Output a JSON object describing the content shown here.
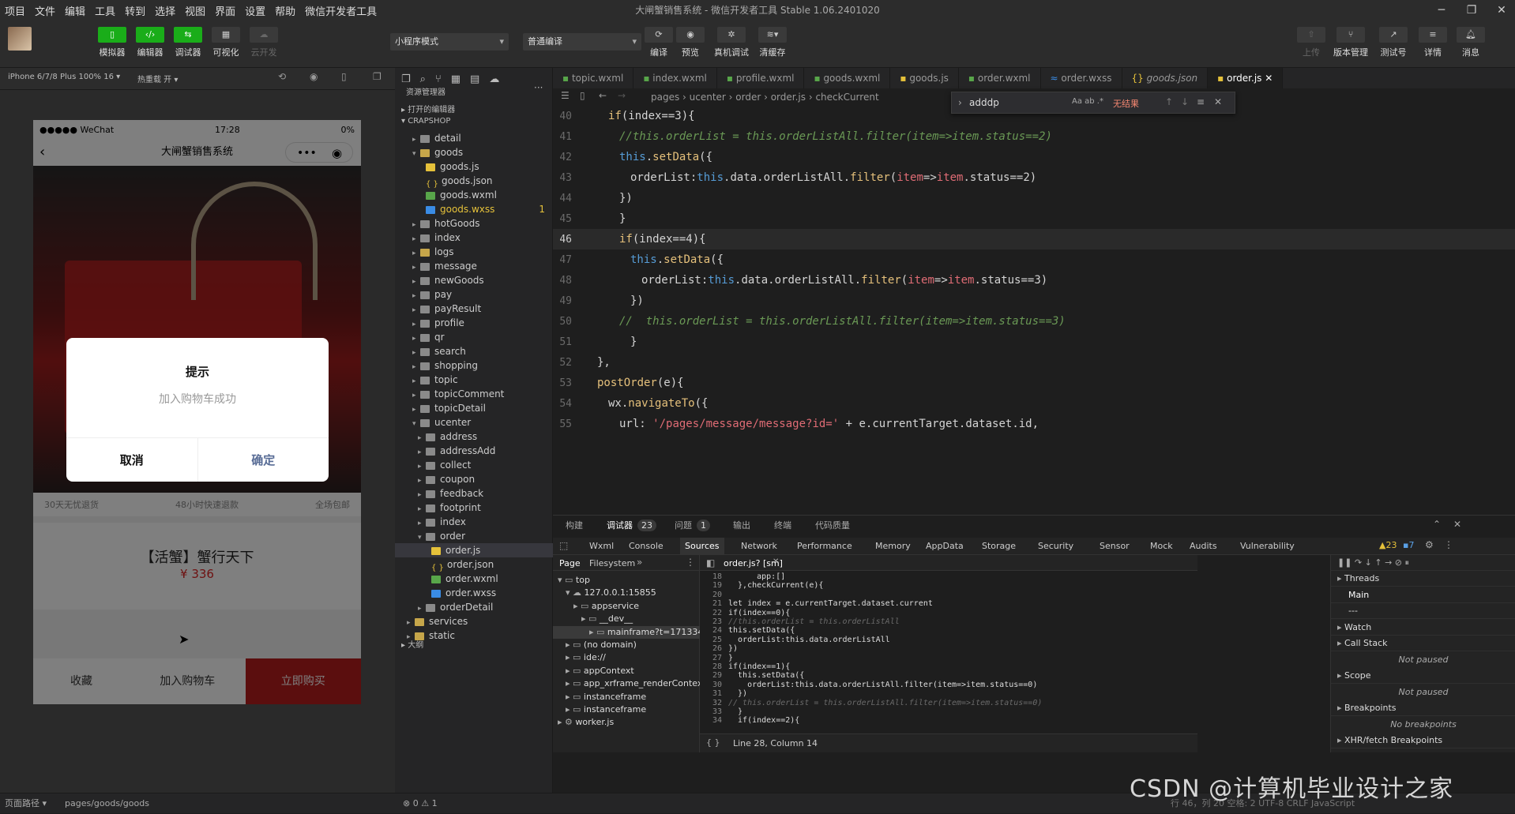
{
  "menu": [
    "项目",
    "文件",
    "编辑",
    "工具",
    "转到",
    "选择",
    "视图",
    "界面",
    "设置",
    "帮助",
    "微信开发者工具"
  ],
  "window_title": "大闸蟹销售系统 - 微信开发者工具 Stable 1.06.2401020",
  "toolbar": {
    "left_buttons": [
      "模拟器",
      "编辑器",
      "调试器",
      "可视化",
      "云开发"
    ],
    "mode_select": "小程序模式",
    "compile_select": "普通编译",
    "mid_buttons": [
      "编译",
      "预览",
      "真机调试",
      "清缓存"
    ],
    "right_buttons": [
      "上传",
      "版本管理",
      "测试号",
      "详情",
      "消息"
    ]
  },
  "simulator": {
    "device": "iPhone 6/7/8 Plus 100% 16 ▾",
    "hotreload": "热重载 开 ▾",
    "status_left": "●●●●● WeChat",
    "status_time": "17:28",
    "status_right": "0%",
    "nav_title": "大闸蟹销售系统",
    "services": [
      "30天无忧退货",
      "48小时快速退款",
      "全场包邮"
    ],
    "product_name": "【活蟹】蟹行天下",
    "price": "¥ 336",
    "bottom_actions": [
      "收藏",
      "加入购物车",
      "立即购买"
    ],
    "dialog": {
      "title": "提示",
      "content": "加入购物车成功",
      "cancel": "取消",
      "confirm": "确定"
    }
  },
  "explorer": {
    "header": "资源管理器",
    "open_editors": "打开的编辑器",
    "project": "CRAPSHOP",
    "outline": "大纲",
    "rows": [
      {
        "label": "detail",
        "kind": "folder",
        "indent": 2,
        "caret": "▸"
      },
      {
        "label": "goods",
        "kind": "gfolder",
        "indent": 2,
        "caret": "▾"
      },
      {
        "label": "goods.js",
        "kind": "js",
        "indent": 3,
        "caret": ""
      },
      {
        "label": "goods.json",
        "kind": "json",
        "indent": 3,
        "caret": ""
      },
      {
        "label": "goods.wxml",
        "kind": "wxml",
        "indent": 3,
        "caret": ""
      },
      {
        "label": "goods.wxss",
        "kind": "wxss",
        "indent": 3,
        "caret": "",
        "badge": "1"
      },
      {
        "label": "hotGoods",
        "kind": "folder",
        "indent": 2,
        "caret": "▸"
      },
      {
        "label": "index",
        "kind": "folder",
        "indent": 2,
        "caret": "▸"
      },
      {
        "label": "logs",
        "kind": "gfolder",
        "indent": 2,
        "caret": "▸"
      },
      {
        "label": "message",
        "kind": "folder",
        "indent": 2,
        "caret": "▸"
      },
      {
        "label": "newGoods",
        "kind": "folder",
        "indent": 2,
        "caret": "▸"
      },
      {
        "label": "pay",
        "kind": "folder",
        "indent": 2,
        "caret": "▸"
      },
      {
        "label": "payResult",
        "kind": "folder",
        "indent": 2,
        "caret": "▸"
      },
      {
        "label": "profile",
        "kind": "folder",
        "indent": 2,
        "caret": "▸"
      },
      {
        "label": "qr",
        "kind": "folder",
        "indent": 2,
        "caret": "▸"
      },
      {
        "label": "search",
        "kind": "folder",
        "indent": 2,
        "caret": "▸"
      },
      {
        "label": "shopping",
        "kind": "folder",
        "indent": 2,
        "caret": "▸"
      },
      {
        "label": "topic",
        "kind": "folder",
        "indent": 2,
        "caret": "▸"
      },
      {
        "label": "topicComment",
        "kind": "folder",
        "indent": 2,
        "caret": "▸"
      },
      {
        "label": "topicDetail",
        "kind": "folder",
        "indent": 2,
        "caret": "▸"
      },
      {
        "label": "ucenter",
        "kind": "folder",
        "indent": 2,
        "caret": "▾"
      },
      {
        "label": "address",
        "kind": "folder",
        "indent": 3,
        "caret": "▸"
      },
      {
        "label": "addressAdd",
        "kind": "folder",
        "indent": 3,
        "caret": "▸"
      },
      {
        "label": "collect",
        "kind": "folder",
        "indent": 3,
        "caret": "▸"
      },
      {
        "label": "coupon",
        "kind": "folder",
        "indent": 3,
        "caret": "▸"
      },
      {
        "label": "feedback",
        "kind": "folder",
        "indent": 3,
        "caret": "▸"
      },
      {
        "label": "footprint",
        "kind": "folder",
        "indent": 3,
        "caret": "▸"
      },
      {
        "label": "index",
        "kind": "folder",
        "indent": 3,
        "caret": "▸"
      },
      {
        "label": "order",
        "kind": "folder",
        "indent": 3,
        "caret": "▾"
      },
      {
        "label": "order.js",
        "kind": "js",
        "indent": 4,
        "caret": "",
        "selected": true
      },
      {
        "label": "order.json",
        "kind": "json",
        "indent": 4,
        "caret": ""
      },
      {
        "label": "order.wxml",
        "kind": "wxml",
        "indent": 4,
        "caret": ""
      },
      {
        "label": "order.wxss",
        "kind": "wxss",
        "indent": 4,
        "caret": ""
      },
      {
        "label": "orderDetail",
        "kind": "folder",
        "indent": 3,
        "caret": "▸"
      },
      {
        "label": "services",
        "kind": "gfolder",
        "indent": 1,
        "caret": "▸"
      },
      {
        "label": "static",
        "kind": "gfolder",
        "indent": 1,
        "caret": "▸"
      }
    ]
  },
  "editor": {
    "tabs": [
      "topic.wxml",
      "index.wxml",
      "profile.wxml",
      "goods.wxml",
      "goods.js",
      "order.wxml",
      "order.wxss",
      "goods.json",
      "order.js"
    ],
    "active_tab": "order.js",
    "breadcrumb": "pages › ucenter › order › order.js › checkCurrent",
    "find": {
      "query": "adddp",
      "result": "无结果"
    },
    "lines": [
      {
        "n": "40",
        "indent": 1,
        "text": "if(index==3){",
        "type": "code"
      },
      {
        "n": "41",
        "indent": 2,
        "text": "//this.orderList = this.orderListAll.filter(item=>item.status==2)",
        "type": "com"
      },
      {
        "n": "42",
        "indent": 2,
        "text": "this.setData({",
        "type": "code"
      },
      {
        "n": "43",
        "indent": 3,
        "text": "orderList:this.data.orderListAll.filter(item=>item.status==2)",
        "type": "code"
      },
      {
        "n": "44",
        "indent": 2,
        "text": "})",
        "type": "code"
      },
      {
        "n": "45",
        "indent": 2,
        "text": "}",
        "type": "code"
      },
      {
        "n": "46",
        "indent": 2,
        "text": "if(index==4){",
        "type": "code",
        "current": true
      },
      {
        "n": "47",
        "indent": 3,
        "text": "this.setData({",
        "type": "code"
      },
      {
        "n": "48",
        "indent": 4,
        "text": "orderList:this.data.orderListAll.filter(item=>item.status==3)",
        "type": "code"
      },
      {
        "n": "49",
        "indent": 3,
        "text": "})",
        "type": "code"
      },
      {
        "n": "50",
        "indent": 2,
        "text": "//  this.orderList = this.orderListAll.filter(item=>item.status==3)",
        "type": "com"
      },
      {
        "n": "51",
        "indent": 3,
        "text": "}",
        "type": "code"
      },
      {
        "n": "52",
        "indent": 0,
        "text": "},",
        "type": "code"
      },
      {
        "n": "53",
        "indent": 0,
        "text": "postOrder(e){",
        "type": "code"
      },
      {
        "n": "54",
        "indent": 1,
        "text": "wx.navigateTo({",
        "type": "code"
      },
      {
        "n": "55",
        "indent": 2,
        "text": "url: '/pages/message/message?id=' + e.currentTarget.dataset.id,",
        "type": "code"
      }
    ]
  },
  "panel": {
    "tabs": [
      {
        "label": "构建",
        "count": ""
      },
      {
        "label": "调试器",
        "count": "23"
      },
      {
        "label": "问题",
        "count": "1"
      },
      {
        "label": "输出",
        "count": ""
      },
      {
        "label": "终端",
        "count": ""
      },
      {
        "label": "代码质量",
        "count": ""
      }
    ],
    "devtools_tabs": [
      "Wxml",
      "Console",
      "Sources",
      "Network",
      "Performance",
      "Memory",
      "AppData",
      "Storage",
      "Security",
      "Sensor",
      "Mock",
      "Audits",
      "Vulnerability"
    ],
    "active_devtab": "Sources",
    "warn_count": "23",
    "info_count": "7",
    "sources_subtabs": [
      "Page",
      "Filesystem"
    ],
    "source_tree": [
      {
        "label": "top",
        "indent": 0
      },
      {
        "label": "127.0.0.1:15855",
        "indent": 1
      },
      {
        "label": "appservice",
        "indent": 2
      },
      {
        "label": "__dev__",
        "indent": 3
      },
      {
        "label": "mainframe?t=171334364750",
        "indent": 4
      },
      {
        "label": "(no domain)",
        "indent": 1
      },
      {
        "label": "ide://",
        "indent": 1
      },
      {
        "label": "appContext",
        "indent": 1
      },
      {
        "label": "app_xrframe_renderContext",
        "indent": 1
      },
      {
        "label": "instanceframe",
        "indent": 1
      },
      {
        "label": "instanceframe",
        "indent": 1
      },
      {
        "label": "worker.js",
        "indent": 0
      }
    ],
    "source_file_tab": "order.js? [sm]",
    "source_lines": [
      {
        "n": "18",
        "t": "      app:[]"
      },
      {
        "n": "19",
        "t": "  },checkCurrent(e){"
      },
      {
        "n": "20",
        "t": ""
      },
      {
        "n": "21",
        "t": "let index = e.currentTarget.dataset.current"
      },
      {
        "n": "22",
        "t": "if(index==0){"
      },
      {
        "n": "23",
        "t": "//this.orderList = this.orderListAll"
      },
      {
        "n": "24",
        "t": "this.setData({"
      },
      {
        "n": "25",
        "t": "  orderList:this.data.orderListAll"
      },
      {
        "n": "26",
        "t": "})"
      },
      {
        "n": "27",
        "t": "}"
      },
      {
        "n": "28",
        "t": "if(index==1){"
      },
      {
        "n": "29",
        "t": "  this.setData({"
      },
      {
        "n": "30",
        "t": "    orderList:this.data.orderListAll.filter(item=>item.status==0)"
      },
      {
        "n": "31",
        "t": "  })"
      },
      {
        "n": "32",
        "t": "// this.orderList = this.orderListAll.filter(item=>item.status==0)"
      },
      {
        "n": "33",
        "t": "  }"
      },
      {
        "n": "34",
        "t": "  if(index==2){"
      }
    ],
    "cursor_pos": "Line 28, Column 14",
    "right_sections": [
      {
        "label": "Threads",
        "kind": "head"
      },
      {
        "label": "Main",
        "kind": "item"
      },
      {
        "label": "---",
        "kind": "item"
      },
      {
        "label": "Watch",
        "kind": "head"
      },
      {
        "label": "Call Stack",
        "kind": "head"
      },
      {
        "label": "Not paused",
        "kind": "note"
      },
      {
        "label": "Scope",
        "kind": "head"
      },
      {
        "label": "Not paused",
        "kind": "note"
      },
      {
        "label": "Breakpoints",
        "kind": "head"
      },
      {
        "label": "No breakpoints",
        "kind": "note"
      },
      {
        "label": "XHR/fetch Breakpoints",
        "kind": "head"
      }
    ]
  },
  "statusbar": {
    "page_path_label": "页面路径 ▾",
    "page_path": "pages/goods/goods",
    "problems": "⊗ 0 ⚠ 1",
    "right": "行 46，列 20    空格: 2    UTF-8    CRLF    JavaScript"
  },
  "watermark": "CSDN @计算机毕业设计之家",
  "colors": {
    "accent_green": "#1aad19",
    "buy_red": "#b61c1c",
    "dialog_confirm": "#576b95",
    "price_red": "#d22"
  }
}
